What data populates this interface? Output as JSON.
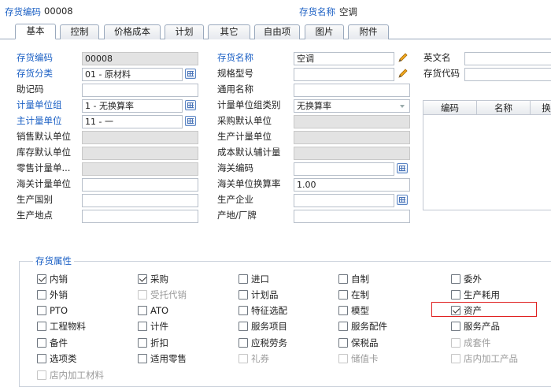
{
  "header": {
    "code_label": "存货编码",
    "code_value": "00008",
    "name_label": "存货名称",
    "name_value": "空调"
  },
  "tabs": [
    "基本",
    "控制",
    "价格成本",
    "计划",
    "其它",
    "自由项",
    "图片",
    "附件"
  ],
  "form": {
    "col1": [
      {
        "label": "存货编码",
        "value": "00008",
        "required": true
      },
      {
        "label": "存货分类",
        "value": "01 - 原材料",
        "required": true
      },
      {
        "label": "助记码",
        "value": "",
        "required": false
      },
      {
        "label": "计量单位组",
        "value": "1 - 无换算率",
        "required": true
      },
      {
        "label": "主计量单位",
        "value": "11 - 一",
        "required": true
      },
      {
        "label": "销售默认单位",
        "value": "",
        "required": false
      },
      {
        "label": "库存默认单位",
        "value": "",
        "required": false
      },
      {
        "label": "零售计量单...",
        "value": "",
        "required": false
      },
      {
        "label": "海关计量单位",
        "value": "",
        "required": false
      },
      {
        "label": "生产国别",
        "value": "",
        "required": false
      },
      {
        "label": "生产地点",
        "value": "",
        "required": false
      }
    ],
    "col2": [
      {
        "label": "存货名称",
        "value": "空调",
        "required": true
      },
      {
        "label": "规格型号",
        "value": "",
        "required": false
      },
      {
        "label": "通用名称",
        "value": "",
        "required": false
      },
      {
        "label": "计量单位组类别",
        "value": "无换算率",
        "required": false
      },
      {
        "label": "采购默认单位",
        "value": "",
        "required": false
      },
      {
        "label": "生产计量单位",
        "value": "",
        "required": false
      },
      {
        "label": "成本默认辅计量",
        "value": "",
        "required": false
      },
      {
        "label": "海关编码",
        "value": "",
        "required": false
      },
      {
        "label": "海关单位换算率",
        "value": "1.00",
        "required": false
      },
      {
        "label": "生产企业",
        "value": "",
        "required": false
      },
      {
        "label": "产地/厂牌",
        "value": "",
        "required": false
      }
    ],
    "col3": [
      {
        "label": "英文名",
        "value": ""
      },
      {
        "label": "存货代码",
        "value": ""
      }
    ]
  },
  "grid": {
    "columns": [
      "编码",
      "名称",
      "换"
    ]
  },
  "attributes": {
    "legend": "存货属性",
    "rows": [
      [
        {
          "label": "内销",
          "checked": true,
          "disabled": false
        },
        {
          "label": "采购",
          "checked": true,
          "disabled": false
        },
        {
          "label": "进口",
          "checked": false,
          "disabled": false
        },
        {
          "label": "自制",
          "checked": false,
          "disabled": false
        },
        {
          "label": "委外",
          "checked": false,
          "disabled": false
        }
      ],
      [
        {
          "label": "外销",
          "checked": false,
          "disabled": false
        },
        {
          "label": "受托代销",
          "checked": false,
          "disabled": true
        },
        {
          "label": "计划品",
          "checked": false,
          "disabled": false
        },
        {
          "label": "在制",
          "checked": false,
          "disabled": false
        },
        {
          "label": "生产耗用",
          "checked": false,
          "disabled": false
        }
      ],
      [
        {
          "label": "PTO",
          "checked": false,
          "disabled": false
        },
        {
          "label": "ATO",
          "checked": false,
          "disabled": false
        },
        {
          "label": "特征选配",
          "checked": false,
          "disabled": false
        },
        {
          "label": "模型",
          "checked": false,
          "disabled": false
        },
        {
          "label": "资产",
          "checked": true,
          "disabled": false
        }
      ],
      [
        {
          "label": "工程物料",
          "checked": false,
          "disabled": false
        },
        {
          "label": "计件",
          "checked": false,
          "disabled": false
        },
        {
          "label": "服务项目",
          "checked": false,
          "disabled": false
        },
        {
          "label": "服务配件",
          "checked": false,
          "disabled": false
        },
        {
          "label": "服务产品",
          "checked": false,
          "disabled": false
        }
      ],
      [
        {
          "label": "备件",
          "checked": false,
          "disabled": false
        },
        {
          "label": "折扣",
          "checked": false,
          "disabled": false
        },
        {
          "label": "应税劳务",
          "checked": false,
          "disabled": false
        },
        {
          "label": "保税品",
          "checked": false,
          "disabled": false
        },
        {
          "label": "成套件",
          "checked": false,
          "disabled": true
        }
      ],
      [
        {
          "label": "选项类",
          "checked": false,
          "disabled": false
        },
        {
          "label": "适用零售",
          "checked": false,
          "disabled": false
        },
        {
          "label": "礼券",
          "checked": false,
          "disabled": true
        },
        {
          "label": "储值卡",
          "checked": false,
          "disabled": true
        },
        {
          "label": "店内加工产品",
          "checked": false,
          "disabled": true
        }
      ],
      [
        {
          "label": "店内加工材料",
          "checked": false,
          "disabled": true
        }
      ]
    ]
  },
  "colors": {
    "accent": "#1a5fc4",
    "highlight": "#e02020"
  }
}
